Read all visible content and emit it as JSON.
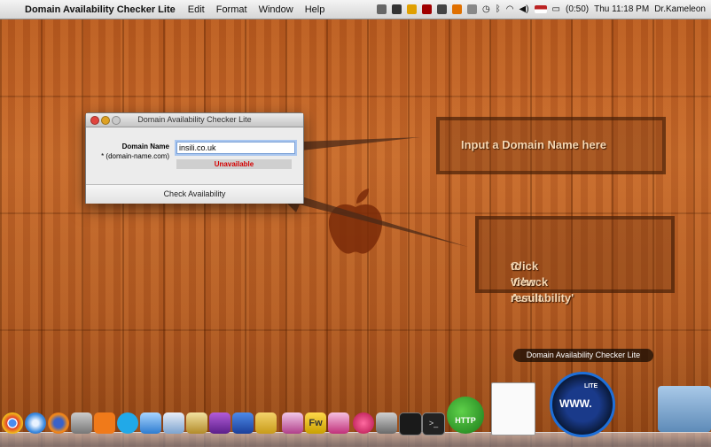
{
  "menubar": {
    "app_name": "Domain Availability Checker Lite",
    "menus": [
      "Edit",
      "Format",
      "Window",
      "Help"
    ],
    "battery": "(0:50)",
    "clock": "Thu 11:18 PM",
    "user": "Dr.Kameleon"
  },
  "window": {
    "title": "Domain Availability Checker Lite",
    "field_label": "Domain Name",
    "field_hint": "* (domain-name.com)",
    "domain_value": "insili.co.uk",
    "result": "Unavailable",
    "check_button": "Check Availability"
  },
  "notes": {
    "input_hint": "Input a Domain Name here",
    "click_hint_line1": "Click 'Check Availability'",
    "click_hint_line2": "to view result"
  },
  "dock": {
    "tooltip": "Domain Availability Checker Lite",
    "http_label": "HTTP",
    "www_label": "WWW.",
    "lite_label": "LITE"
  },
  "colors": {
    "result_text": "#d40000",
    "wood": "#c7692a"
  }
}
